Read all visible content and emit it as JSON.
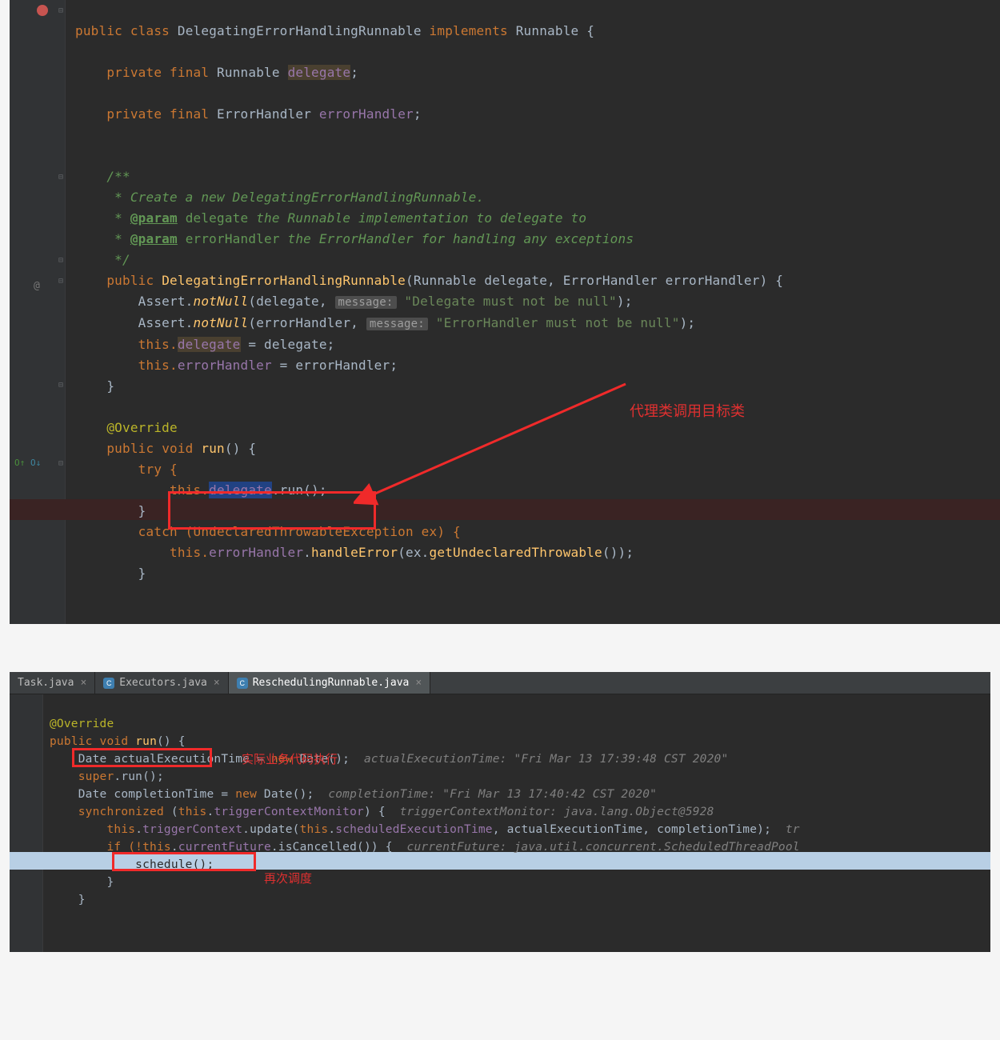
{
  "panel1": {
    "line1": {
      "public": "public",
      "class": "class",
      "name": "DelegatingErrorHandlingRunnable",
      "implements": "implements",
      "iface": "Runnable"
    },
    "field1": {
      "private": "private",
      "final": "final",
      "type": "Runnable",
      "name": "delegate"
    },
    "field2": {
      "private": "private",
      "final": "final",
      "type": "ErrorHandler",
      "name": "errorHandler"
    },
    "doc1": "/**",
    "doc2": " * Create a new DelegatingErrorHandlingRunnable.",
    "doc3a": " * ",
    "doc3tag": "@param",
    "doc3name": "delegate",
    "doc3rest": " the Runnable implementation to delegate to",
    "doc4a": " * ",
    "doc4tag": "@param",
    "doc4name": "errorHandler",
    "doc4rest": " the ErrorHandler for handling any exceptions",
    "doc5": " */",
    "ctor": {
      "public": "public",
      "name": "DelegatingErrorHandlingRunnable",
      "p1type": "Runnable",
      "p1": "delegate",
      "p2type": "ErrorHandler",
      "p2": "errorHandler"
    },
    "assert1_a": "Assert.",
    "assert1_m": "notNull",
    "assert1_open": "(delegate, ",
    "hint_msg": "message:",
    "assert1_str": "\"Delegate must not be null\"",
    "assert1_close": ");",
    "assert2_a": "Assert.",
    "assert2_m": "notNull",
    "assert2_open": "(errorHandler, ",
    "assert2_str": "\"ErrorHandler must not be null\"",
    "assert2_close": ");",
    "assign1": "this.",
    "assign1_fld": "delegate",
    "assign1_rest": " = delegate;",
    "assign2": "this.",
    "assign2_fld": "errorHandler",
    "assign2_rest": " = errorHandler;",
    "gutter_at": "@",
    "override": "@Override",
    "run": {
      "public": "public",
      "void": "void",
      "name": "run"
    },
    "try": "try {",
    "delegate_call_pre": "this.",
    "delegate_call_fld": "delegate",
    "delegate_call_post": ".run();",
    "brace_close": "}",
    "catch": "catch (UndeclaredThrowableException ex) {",
    "handle_pre": "this.",
    "handle_fld": "errorHandler",
    "handle_mid": ".",
    "handle_m": "handleError",
    "handle_open": "(ex.",
    "handle_m2": "getUndeclaredThrowable",
    "handle_close": "());",
    "annotation": "代理类调用目标类"
  },
  "tabs": {
    "t1": "Task.java",
    "t2": "Executors.java",
    "t3": "ReschedulingRunnable.java"
  },
  "panel2": {
    "override": "@Override",
    "run": {
      "public": "public",
      "void": "void",
      "name": "run"
    },
    "l3_a": "Date actualExecutionTime = ",
    "l3_new": "new",
    "l3_b": " Date();  ",
    "l3_hint": "actualExecutionTime: \"Fri Mar 13 17:39:48 CST 2020\"",
    "l4_a": "super",
    "l4_b": ".run();",
    "l4_ann": "实际业务代码执行",
    "l5_a": "Date completionTime = ",
    "l5_new": "new",
    "l5_b": " Date();  ",
    "l5_hint": "completionTime: \"Fri Mar 13 17:40:42 CST 2020\"",
    "l6_a": "synchronized ",
    "l6_b": "(",
    "l6_this": "this",
    "l6_c": ".",
    "l6_fld": "triggerContextMonitor",
    "l6_d": ") {  ",
    "l6_hint": "triggerContextMonitor: java.lang.Object@5928",
    "l7_a": "this",
    "l7_b": ".",
    "l7_fld": "triggerContext",
    "l7_c": ".update(",
    "l7_this2": "this",
    "l7_d": ".",
    "l7_fld2": "scheduledExecutionTime",
    "l7_e": ", actualExecutionTime, completionTime);  ",
    "l7_hint": "tr",
    "l8_a": "if (!",
    "l8_this": "this",
    "l8_b": ".",
    "l8_fld": "currentFuture",
    "l8_c": ".isCancelled()) {  ",
    "l8_hint": "currentFuture: java.util.concurrent.ScheduledThreadPool",
    "l9": "schedule();",
    "l9_ann": "再次调度"
  }
}
